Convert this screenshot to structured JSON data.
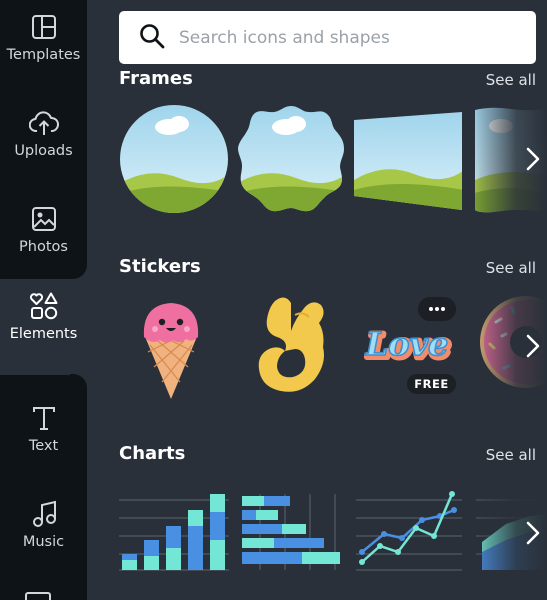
{
  "sidebar": {
    "items": [
      {
        "label": "Templates",
        "icon": "templates-icon"
      },
      {
        "label": "Uploads",
        "icon": "upload-cloud-icon"
      },
      {
        "label": "Photos",
        "icon": "photo-icon"
      },
      {
        "label": "Elements",
        "icon": "elements-shapes-icon",
        "active": true
      },
      {
        "label": "Text",
        "icon": "text-t-icon"
      },
      {
        "label": "Music",
        "icon": "music-note-icon"
      }
    ]
  },
  "search": {
    "placeholder": "Search icons and shapes"
  },
  "sections": {
    "frames": {
      "title": "Frames",
      "see_all": "See all"
    },
    "stickers": {
      "title": "Stickers",
      "see_all": "See all",
      "badge": "FREE"
    },
    "charts": {
      "title": "Charts",
      "see_all": "See all"
    }
  },
  "colors": {
    "panel_bg": "#293039",
    "rail_bg": "#0e1318",
    "chart_teal": "#74e6d6",
    "chart_blue": "#4a90e2"
  }
}
